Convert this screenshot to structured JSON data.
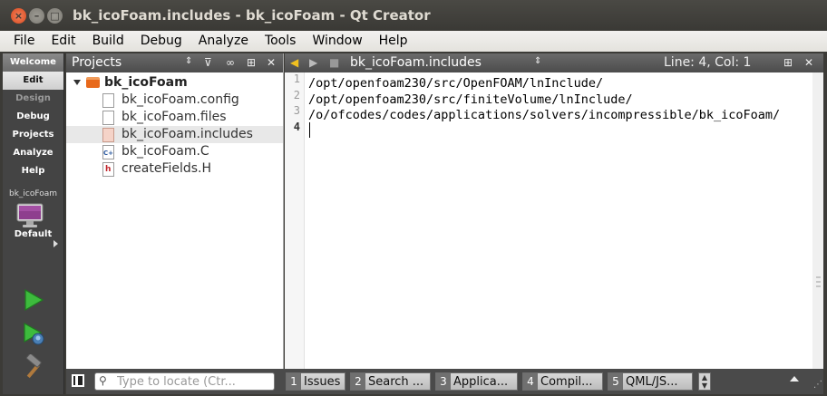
{
  "window": {
    "title": "bk_icoFoam.includes - bk_icoFoam - Qt Creator"
  },
  "menu": {
    "items": [
      "File",
      "Edit",
      "Build",
      "Debug",
      "Analyze",
      "Tools",
      "Window",
      "Help"
    ]
  },
  "modebar": {
    "modes": [
      "Welcome",
      "Edit",
      "Design",
      "Debug",
      "Projects",
      "Analyze",
      "Help"
    ],
    "active": "Edit",
    "kit": {
      "project": "bk_icoFoam",
      "config": "Default"
    }
  },
  "projects": {
    "title": "Projects",
    "root": "bk_icoFoam",
    "files": [
      {
        "name": "bk_icoFoam.config",
        "type": "text"
      },
      {
        "name": "bk_icoFoam.files",
        "type": "text"
      },
      {
        "name": "bk_icoFoam.includes",
        "type": "includes",
        "selected": true
      },
      {
        "name": "bk_icoFoam.C",
        "type": "cpp"
      },
      {
        "name": "createFields.H",
        "type": "header"
      }
    ]
  },
  "editor": {
    "document": "bk_icoFoam.includes",
    "position": "Line: 4, Col: 1",
    "lines": [
      {
        "num": "1",
        "text": "/opt/openfoam230/src/OpenFOAM/lnInclude/"
      },
      {
        "num": "2",
        "text": "/opt/openfoam230/src/finiteVolume/lnInclude/"
      },
      {
        "num": "3",
        "text": "/o/ofcodes/codes/applications/solvers/incompressible/bk_icoFoam/"
      },
      {
        "num": "4",
        "text": ""
      }
    ]
  },
  "statusbar": {
    "locator_placeholder": "Type to locate (Ctr...",
    "panes": [
      {
        "num": "1",
        "label": "Issues"
      },
      {
        "num": "2",
        "label": "Search ..."
      },
      {
        "num": "3",
        "label": "Applica..."
      },
      {
        "num": "4",
        "label": "Compil..."
      },
      {
        "num": "5",
        "label": "QML/JS..."
      }
    ]
  }
}
